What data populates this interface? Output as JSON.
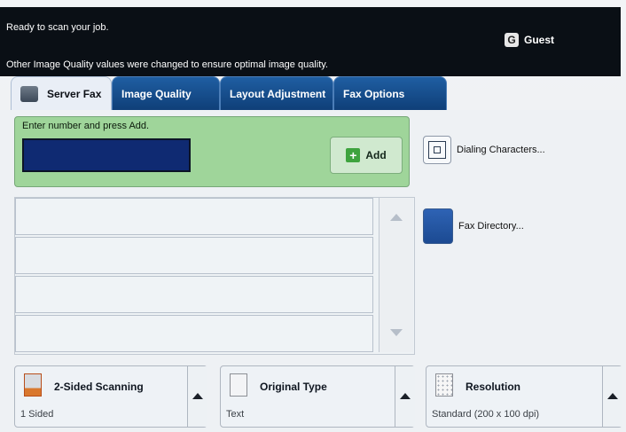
{
  "status": {
    "line1": "Ready to scan your job.",
    "line2": "Other Image Quality values were changed to ensure optimal image quality."
  },
  "user": {
    "label": "Guest",
    "icon": "user-icon"
  },
  "tabs": [
    {
      "label": "Server Fax",
      "active": true
    },
    {
      "label": "Image Quality",
      "active": false
    },
    {
      "label": "Layout Adjustment",
      "active": false
    },
    {
      "label": "Fax Options",
      "active": false
    }
  ],
  "fax_entry": {
    "prompt": "Enter number and press Add.",
    "value": "",
    "add_label": "Add"
  },
  "side_buttons": {
    "dialing": "Dialing Characters...",
    "directory": "Fax Directory..."
  },
  "features": [
    {
      "title": "2-Sided Scanning",
      "value": "1 Sided"
    },
    {
      "title": "Original Type",
      "value": "Text"
    },
    {
      "title": "Resolution",
      "value": "Standard (200 x 100 dpi)"
    }
  ],
  "colors": {
    "top_bar": "#0a0f15",
    "tab_blue": "#1f5ea2",
    "entry_green": "#9fd59a"
  }
}
